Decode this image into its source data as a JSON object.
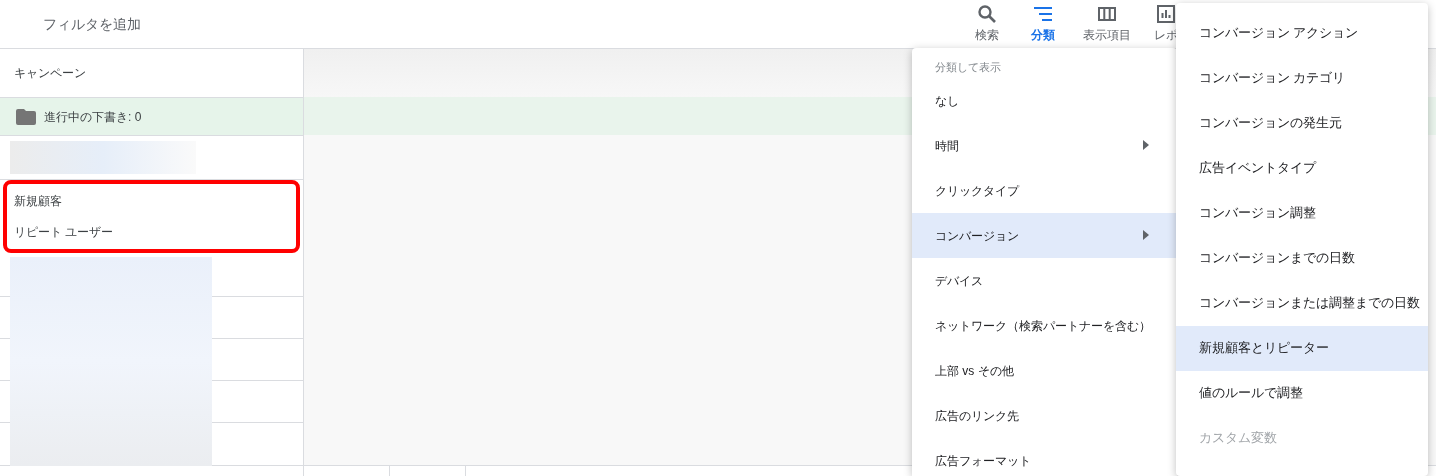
{
  "filter_bar": {
    "placeholder": "フィルタを追加"
  },
  "toolbar": [
    {
      "label": "検索",
      "kind": "search",
      "selected": false
    },
    {
      "label": "分類",
      "kind": "segment",
      "selected": true
    },
    {
      "label": "表示項目",
      "kind": "columns",
      "selected": false
    },
    {
      "label": "レポ",
      "kind": "reports",
      "selected": false
    }
  ],
  "table": {
    "column_header": "キャンペーン",
    "draft_row": {
      "label": "進行中の下書き: ",
      "count": "0"
    },
    "segment_rows": [
      "新規顧客",
      "リピート ユーザー"
    ]
  },
  "segment_menu": {
    "header": "分類して表示",
    "items": [
      {
        "label": "なし",
        "has_submenu": false,
        "selected": false
      },
      {
        "label": "時間",
        "has_submenu": true,
        "selected": false
      },
      {
        "label": "クリックタイプ",
        "has_submenu": false,
        "selected": false
      },
      {
        "label": "コンバージョン",
        "has_submenu": true,
        "selected": true
      },
      {
        "label": "デバイス",
        "has_submenu": false,
        "selected": false
      },
      {
        "label": "ネットワーク（検索パートナーを含む）",
        "has_submenu": false,
        "selected": false
      },
      {
        "label": "上部 vs その他",
        "has_submenu": false,
        "selected": false
      },
      {
        "label": "広告のリンク先",
        "has_submenu": false,
        "selected": false
      },
      {
        "label": "広告フォーマット",
        "has_submenu": false,
        "selected": false
      }
    ]
  },
  "submenu": {
    "items": [
      {
        "label": "コンバージョン アクション",
        "selected": false,
        "disabled": false
      },
      {
        "label": "コンバージョン カテゴリ",
        "selected": false,
        "disabled": false
      },
      {
        "label": "コンバージョンの発生元",
        "selected": false,
        "disabled": false
      },
      {
        "label": "広告イベントタイプ",
        "selected": false,
        "disabled": false
      },
      {
        "label": "コンバージョン調整",
        "selected": false,
        "disabled": false
      },
      {
        "label": "コンバージョンまでの日数",
        "selected": false,
        "disabled": false
      },
      {
        "label": "コンバージョンまたは調整までの日数",
        "selected": false,
        "disabled": false
      },
      {
        "label": "新規顧客とリピーター",
        "selected": true,
        "disabled": false
      },
      {
        "label": "値のルールで調整",
        "selected": false,
        "disabled": false
      },
      {
        "label": "カスタム変数",
        "selected": false,
        "disabled": true
      }
    ]
  }
}
